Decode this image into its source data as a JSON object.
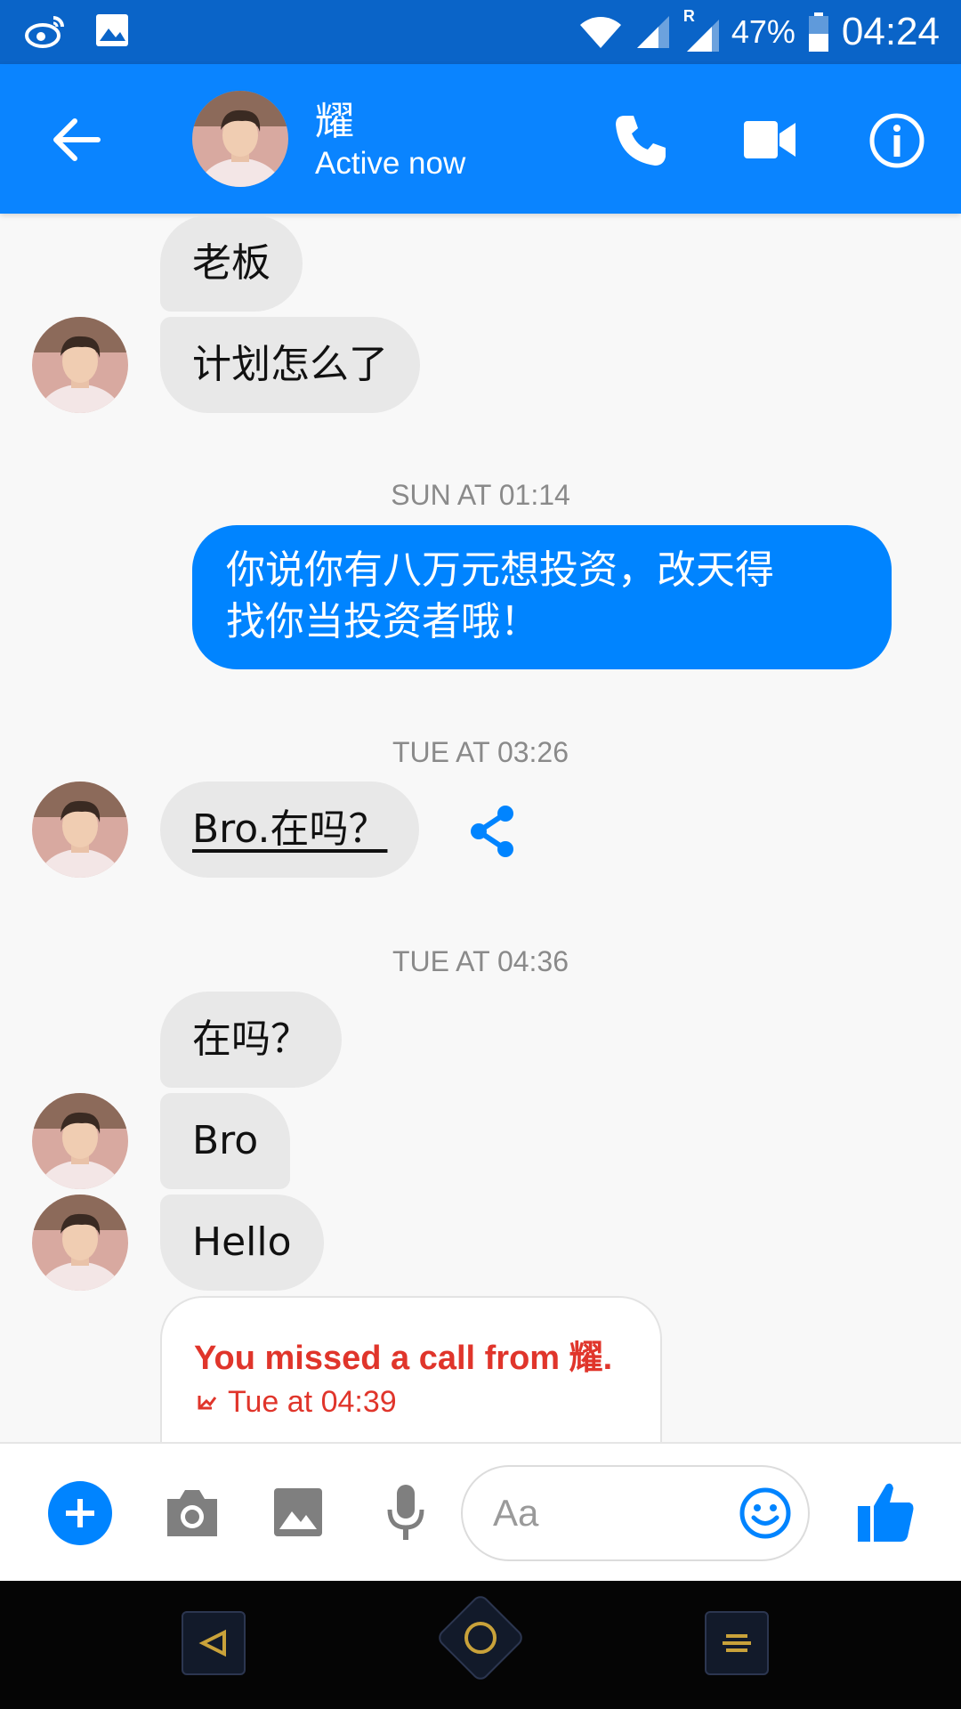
{
  "status_bar": {
    "battery_percent": "47%",
    "time": "04:24",
    "roaming_indicator": "R",
    "icons": [
      "weibo-icon",
      "gallery-icon",
      "wifi-icon",
      "signal-icon",
      "signal-roaming-icon",
      "battery-icon"
    ]
  },
  "header": {
    "contact_name": "耀",
    "contact_status": "Active now",
    "icons": [
      "back-arrow-icon",
      "phone-icon",
      "video-camera-icon",
      "info-icon"
    ]
  },
  "messages": {
    "m1": "老板",
    "m2": "计划怎么了",
    "ts1": "SUN AT 01:14",
    "out1_line1": "你说你有八万元想投资，改天得",
    "out1_line2": "找你当投资者哦！",
    "ts2": "TUE AT 03:26",
    "m3": "Bro.在吗？ ",
    "ts3": "TUE AT 04:36",
    "m4": "在吗？",
    "m5": "Bro",
    "m6": "Hello",
    "missed_call_title": "You missed a call from 耀.",
    "missed_call_time": "Tue at 04:39"
  },
  "composer": {
    "placeholder": "Aa",
    "icons": [
      "plus-icon",
      "camera-icon",
      "photo-icon",
      "microphone-icon",
      "emoji-icon",
      "thumbs-up-icon"
    ]
  },
  "nav_bar": {
    "icons": [
      "nav-back-icon",
      "nav-home-icon",
      "nav-menu-icon"
    ]
  },
  "colors": {
    "status_bar": "#0a64c8",
    "header": "#0a84ff",
    "outgoing_bubble": "#0084ff",
    "incoming_bubble": "#e8e8e8",
    "missed_call": "#e0352b",
    "nav_bar": "#050505"
  }
}
